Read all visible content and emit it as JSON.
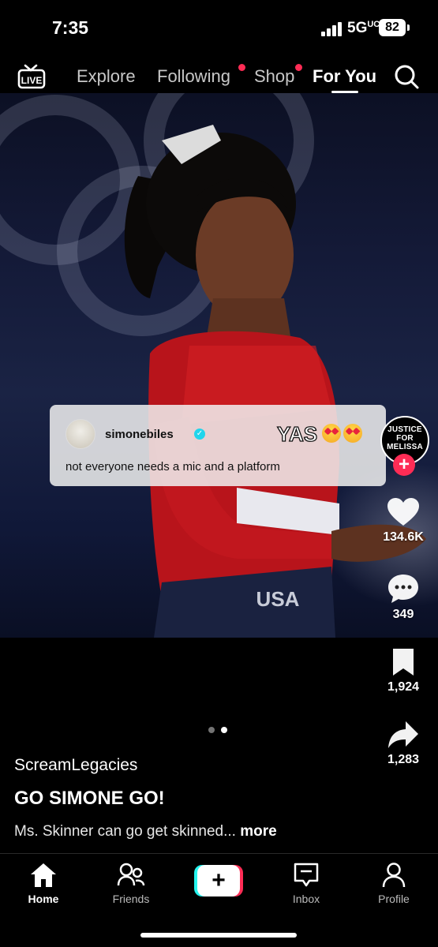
{
  "status_bar": {
    "time": "7:35",
    "network": "5G",
    "battery": "82"
  },
  "top_nav": {
    "live_icon_text": "LIVE",
    "tabs": [
      {
        "label": "Explore"
      },
      {
        "label": "Following",
        "notification_dot": true
      },
      {
        "label": "Shop",
        "notification_dot": true
      },
      {
        "label": "For You",
        "active": true
      }
    ],
    "search_icon": "search-icon"
  },
  "video": {
    "image_description": "Gymnast in red sparkly leotard with USA print, Olympic rings in background",
    "leotard_text": "USA"
  },
  "comment_overlay": {
    "username": "simonebiles",
    "verified": true,
    "text": "not everyone needs a mic and a platform",
    "sticker_text": "YAS",
    "sticker_emoji": "heart-eyes-emoji"
  },
  "creator_avatar": {
    "lines": [
      "JUSTICE",
      "FOR",
      "MELISSA"
    ],
    "follow_icon": "plus-icon"
  },
  "actions": {
    "likes": "134.6K",
    "comments": "349",
    "bookmarks": "1,924",
    "shares": "1,283"
  },
  "carousel": {
    "count": 2,
    "active_index": 1
  },
  "caption": {
    "author": "ScreamLegacies",
    "title": "GO SIMONE GO!",
    "description": "Ms. Skinner can go get skinned...",
    "more_label": "more"
  },
  "tab_bar": {
    "tabs": [
      {
        "label": "Home",
        "icon": "home-icon",
        "active": true
      },
      {
        "label": "Friends",
        "icon": "friends-icon"
      },
      {
        "label": "",
        "icon": "create-plus-icon"
      },
      {
        "label": "Inbox",
        "icon": "inbox-icon"
      },
      {
        "label": "Profile",
        "icon": "profile-icon"
      }
    ]
  },
  "colors": {
    "accent": "#fe2c55",
    "cyan": "#25f4ee",
    "background": "#000000"
  }
}
